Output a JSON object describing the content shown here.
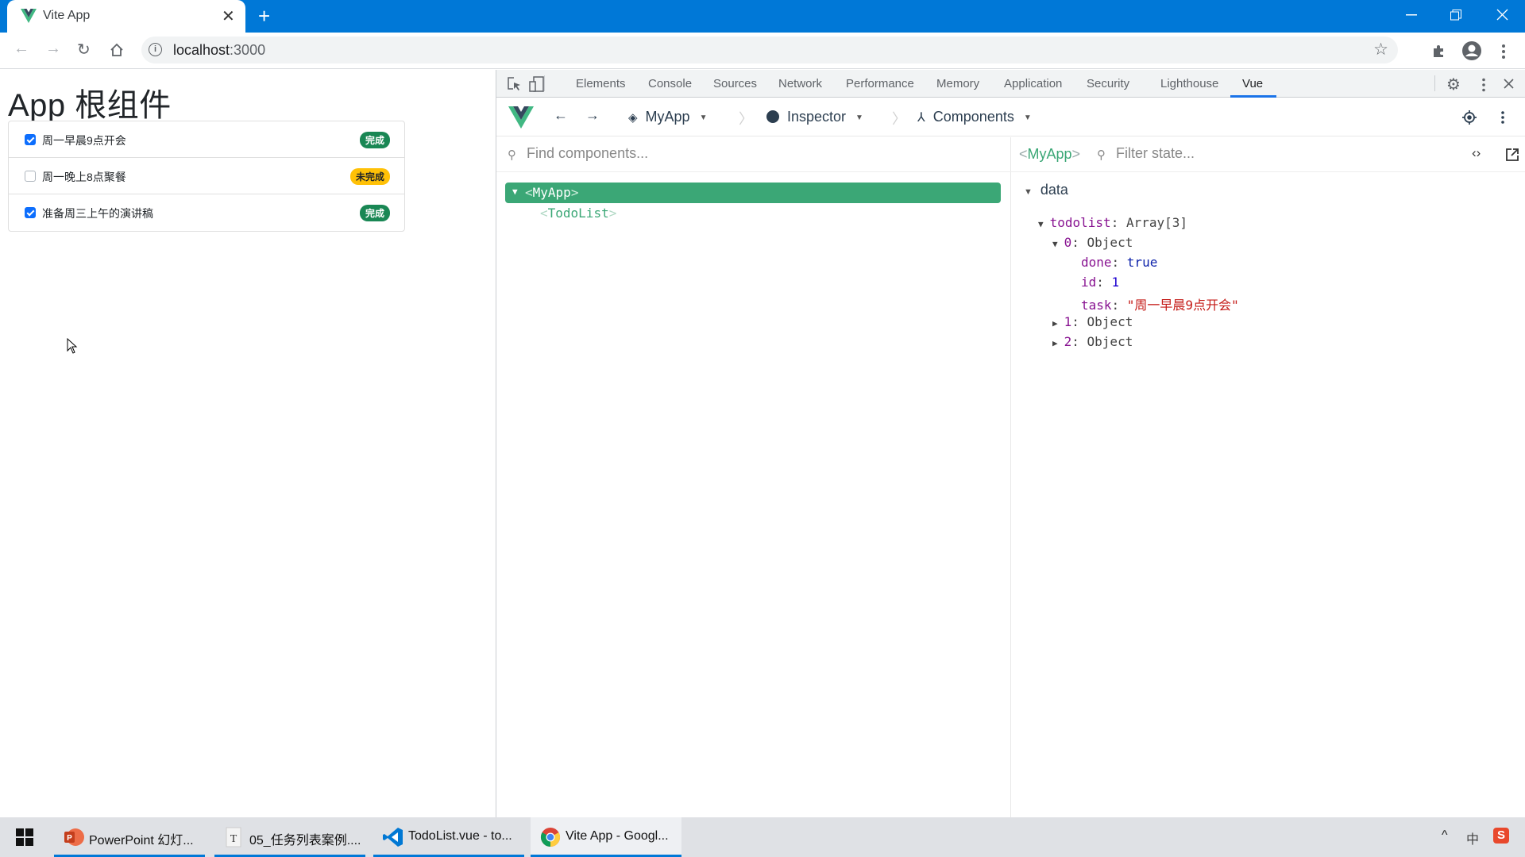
{
  "browser": {
    "tab_title": "Vite App",
    "url_host": "localhost",
    "url_port": ":3000",
    "new_tab_symbol": "+",
    "close_symbol": "✕"
  },
  "page": {
    "heading": "App 根组件",
    "todos": [
      {
        "task": "周一早晨9点开会",
        "done": true,
        "badge": "完成"
      },
      {
        "task": "周一晚上8点聚餐",
        "done": false,
        "badge": "未完成"
      },
      {
        "task": "准备周三上午的演讲稿",
        "done": true,
        "badge": "完成"
      }
    ],
    "colors": {
      "done_badge": "#198754",
      "undone_badge": "#ffc107",
      "checkbox": "#0d6efd"
    }
  },
  "devtools": {
    "tabs": [
      "Elements",
      "Console",
      "Sources",
      "Network",
      "Performance",
      "Memory",
      "Application",
      "Security",
      "Lighthouse",
      "Vue"
    ],
    "active_tab": "Vue",
    "vue": {
      "app_selector": "MyApp",
      "inspector_label": "Inspector",
      "components_label": "Components",
      "find_placeholder": "Find components...",
      "tree": {
        "root": {
          "open": "<",
          "name": "MyApp",
          "close": ">"
        },
        "child": {
          "open": "<",
          "name": "TodoList",
          "close": ">"
        }
      },
      "state": {
        "component_open": "<",
        "component_name": "MyApp",
        "component_close": ">",
        "filter_placeholder": "Filter state...",
        "section": "data",
        "todolist_key": "todolist",
        "todolist_type": "Array[3]",
        "item0_key": "0",
        "item0_type": "Object",
        "done_key": "done",
        "done_value": "true",
        "id_key": "id",
        "id_value": "1",
        "task_key": "task",
        "task_value": "\"周一早晨9点开会\"",
        "item1_key": "1",
        "item1_type": "Object",
        "item2_key": "2",
        "item2_type": "Object"
      },
      "accent": "#3ba776"
    }
  },
  "taskbar": {
    "apps": [
      {
        "label": "PowerPoint 幻灯...",
        "icon": "powerpoint-icon"
      },
      {
        "label": "05_任务列表案例....",
        "icon": "typora-icon"
      },
      {
        "label": "TodoList.vue - to...",
        "icon": "vscode-icon"
      },
      {
        "label": "Vite App - Googl...",
        "icon": "chrome-icon"
      }
    ],
    "tray": {
      "ime": "中",
      "chevron": "^"
    }
  }
}
